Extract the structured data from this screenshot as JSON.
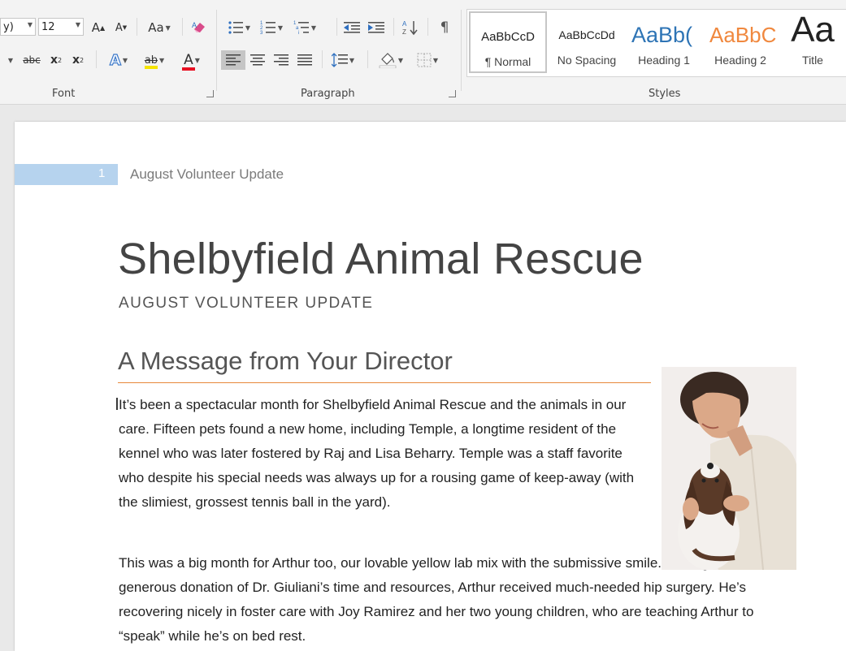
{
  "ribbon": {
    "font": {
      "group_label": "Font",
      "font_name_partial": "y)",
      "font_size": "12",
      "grow_font": "A",
      "shrink_font": "A",
      "change_case": "Aa",
      "strikethrough": "abc",
      "subscript": "x",
      "superscript": "x",
      "text_effects": "A",
      "highlight": "ab",
      "font_color": "A",
      "highlight_color": "#f5e400",
      "font_color_value": "#e81123"
    },
    "paragraph": {
      "group_label": "Paragraph"
    },
    "styles": {
      "group_label": "Styles",
      "items": [
        {
          "sample": "AaBbCcD",
          "name": "¶ Normal"
        },
        {
          "sample": "AaBbCcDd",
          "name": "No Spacing"
        },
        {
          "sample": "AaBb(",
          "name": "Heading 1"
        },
        {
          "sample": "AaBbC",
          "name": "Heading 2"
        },
        {
          "sample": "Aa",
          "name": "Title"
        }
      ],
      "heading_color": "#2e74b5",
      "heading2_color": "#f0883e"
    }
  },
  "document": {
    "header": {
      "page_number": "1",
      "text": "August Volunteer Update"
    },
    "title": "Shelbyfield Animal Rescue",
    "subtitle": "AUGUST VOLUNTEER UPDATE",
    "heading": "A Message from Your Director",
    "paragraphs": [
      "It’s been a spectacular month for Shelbyfield Animal Rescue and the animals in our care. Fifteen pets found a new home, including Temple, a longtime resident of the kennel who was later fostered by Raj and Lisa Beharry. Temple was a staff favorite who despite his special needs was always up for a rousing game of keep-away (with the slimiest, grossest tennis ball in the yard).",
      "This was a big month for Arthur too, our lovable yellow lab mix with the submissive smile. Through the generous donation of Dr. Giuliani’s time and resources, Arthur received much-needed hip surgery. He’s recovering nicely in foster care with Joy Ramirez and her two young children, who are teaching Arthur to “speak” while he’s on bed rest."
    ],
    "heading_rule_color": "#e8873a"
  }
}
